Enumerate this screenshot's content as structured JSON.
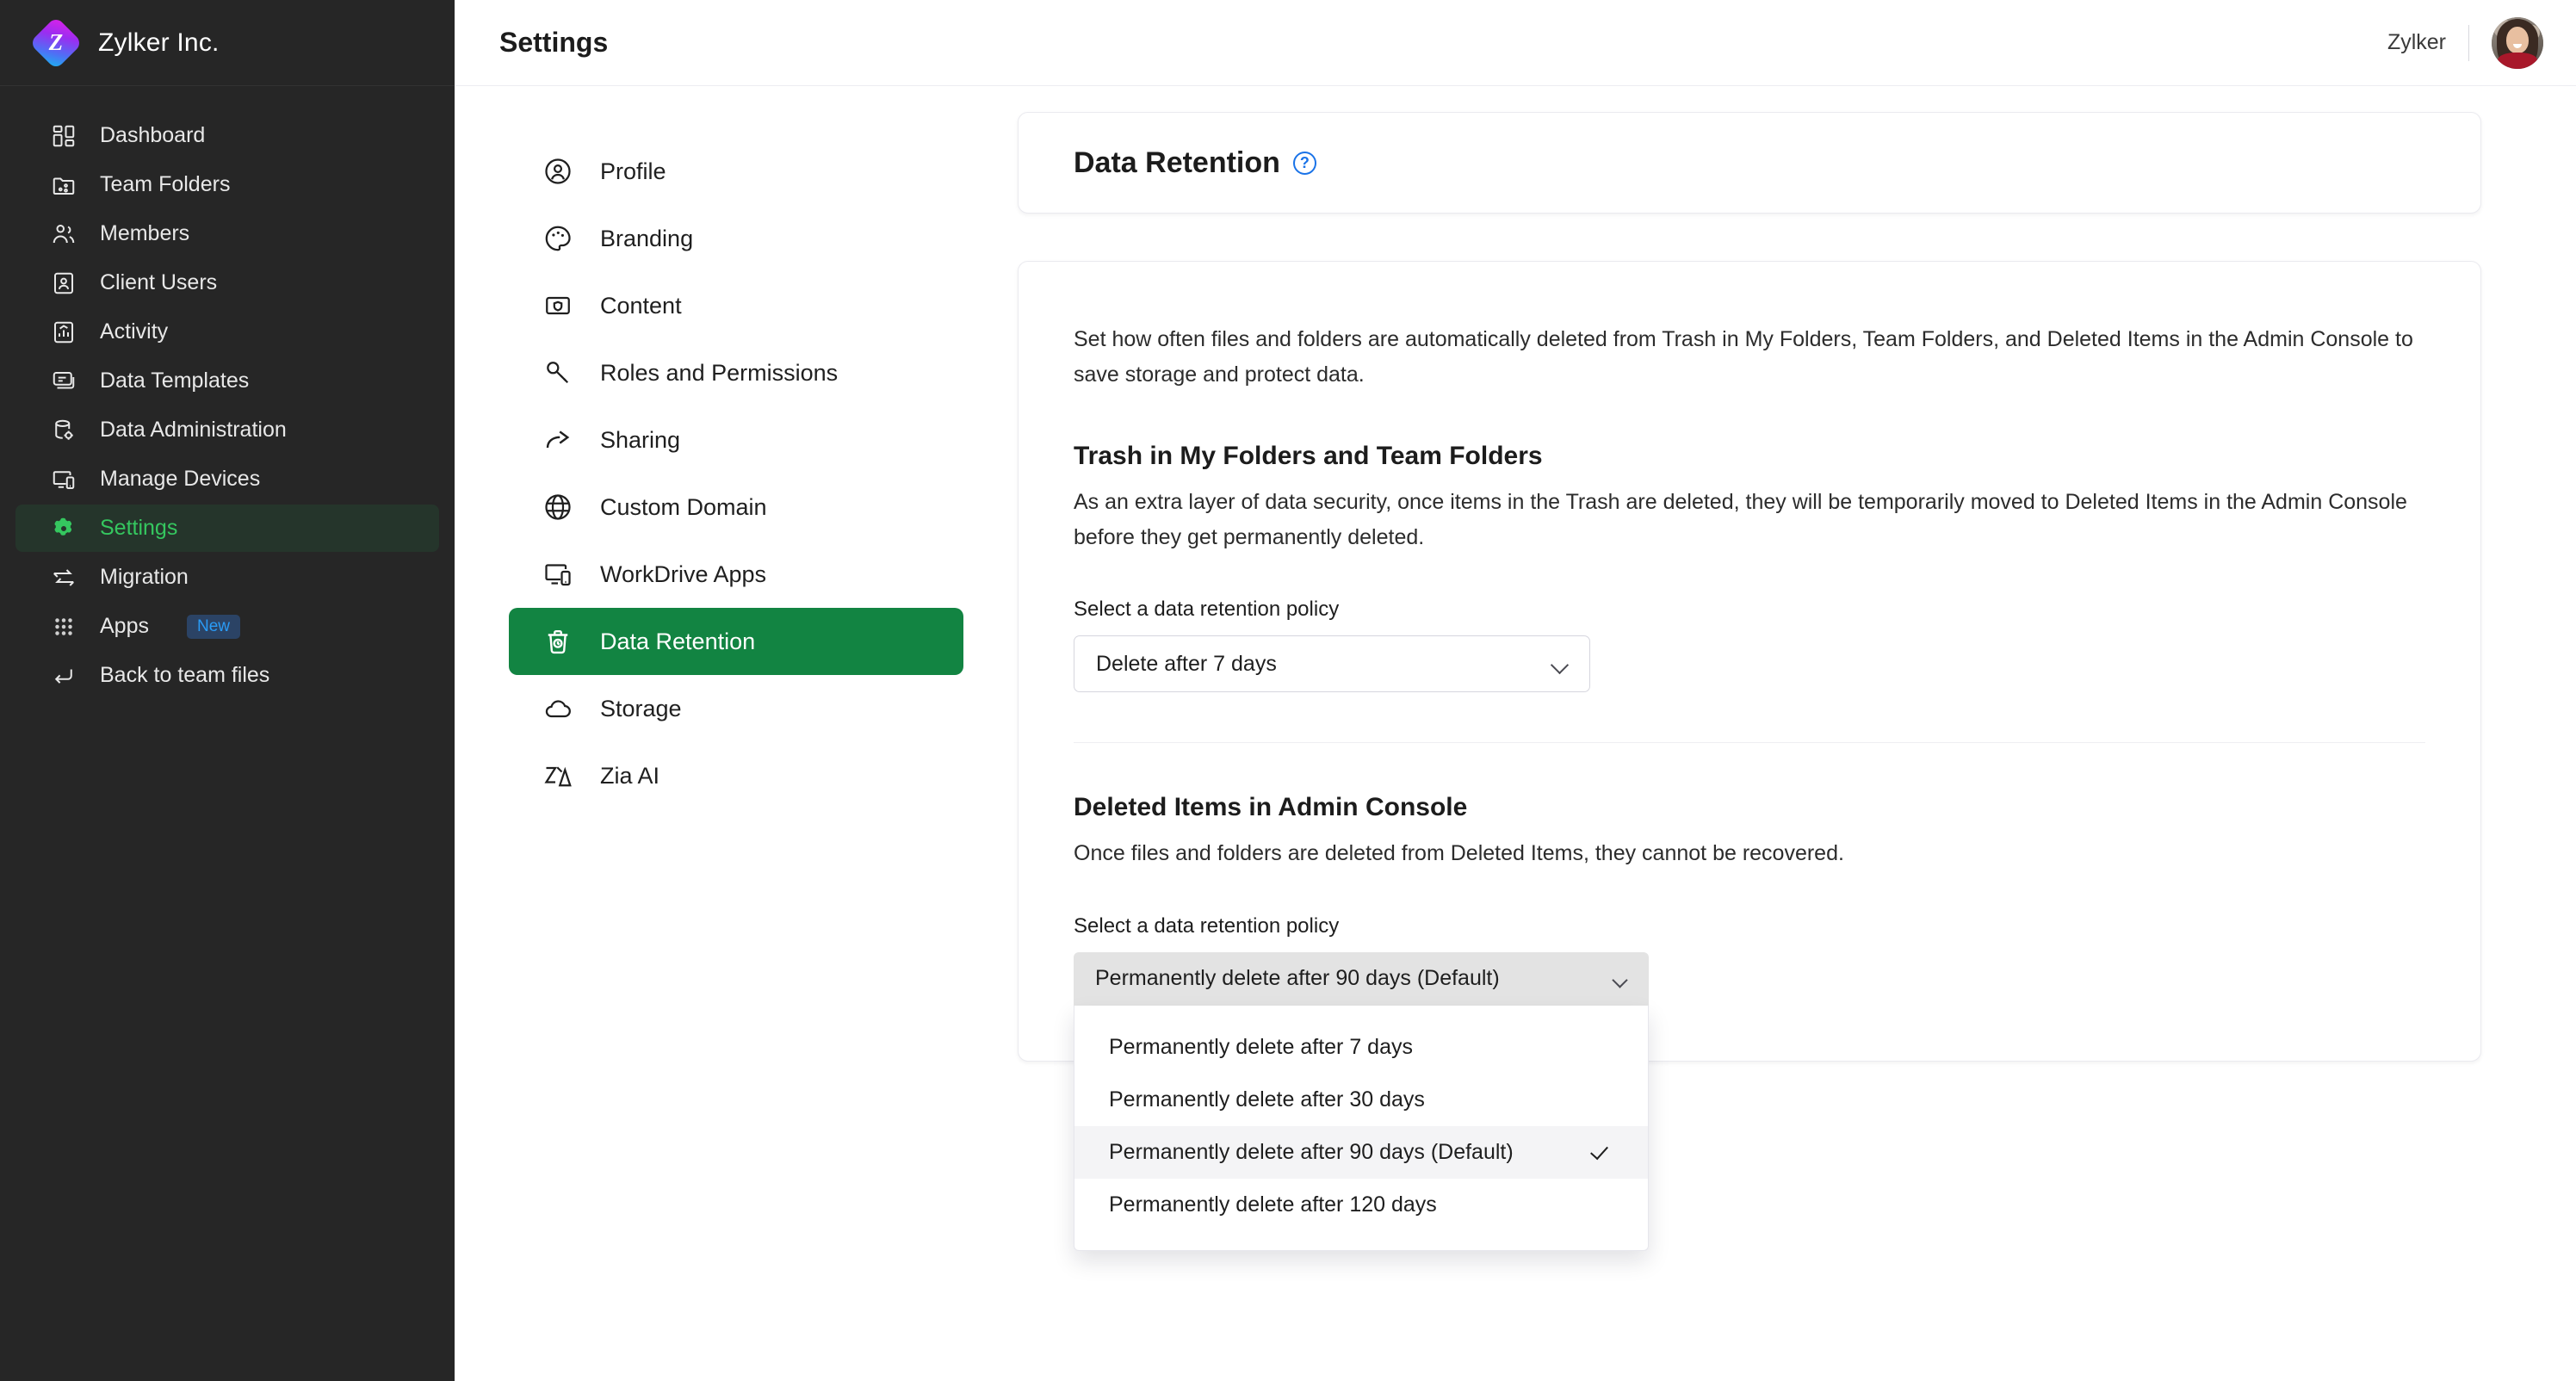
{
  "brand": {
    "name": "Zylker Inc.",
    "logo_glyph": "Z"
  },
  "sidebar": {
    "items": [
      {
        "label": "Dashboard",
        "icon": "grid-icon",
        "active": false
      },
      {
        "label": "Team Folders",
        "icon": "folder-share-icon",
        "active": false
      },
      {
        "label": "Members",
        "icon": "people-icon",
        "active": false
      },
      {
        "label": "Client Users",
        "icon": "id-card-icon",
        "active": false
      },
      {
        "label": "Activity",
        "icon": "activity-report-icon",
        "active": false
      },
      {
        "label": "Data Templates",
        "icon": "template-icon",
        "active": false
      },
      {
        "label": "Data Administration",
        "icon": "database-gear-icon",
        "active": false
      },
      {
        "label": "Manage Devices",
        "icon": "devices-icon",
        "active": false
      },
      {
        "label": "Settings",
        "icon": "gear-icon",
        "active": true
      },
      {
        "label": "Migration",
        "icon": "transfer-arrows-icon",
        "active": false
      },
      {
        "label": "Apps",
        "icon": "apps-grid-icon",
        "active": false,
        "badge": "New"
      },
      {
        "label": "Back to team files",
        "icon": "return-arrow-icon",
        "active": false
      }
    ]
  },
  "topbar": {
    "title": "Settings",
    "org_name": "Zylker",
    "avatar_name": "user-avatar"
  },
  "settings_nav": {
    "items": [
      {
        "label": "Profile",
        "icon": "user-circle-icon",
        "active": false
      },
      {
        "label": "Branding",
        "icon": "palette-icon",
        "active": false
      },
      {
        "label": "Content",
        "icon": "content-shield-icon",
        "active": false
      },
      {
        "label": "Roles and Permissions",
        "icon": "key-icon",
        "active": false
      },
      {
        "label": "Sharing",
        "icon": "share-arrow-icon",
        "active": false
      },
      {
        "label": "Custom Domain",
        "icon": "globe-icon",
        "active": false
      },
      {
        "label": "WorkDrive Apps",
        "icon": "devices-icon",
        "active": false
      },
      {
        "label": "Data Retention",
        "icon": "trash-clock-icon",
        "active": true
      },
      {
        "label": "Storage",
        "icon": "cloud-icon",
        "active": false
      },
      {
        "label": "Zia AI",
        "icon": "zia-icon",
        "active": false
      }
    ]
  },
  "page": {
    "title": "Data Retention",
    "help_glyph": "?",
    "intro": "Set how often files and folders are automatically deleted from Trash in My Folders, Team Folders, and Deleted Items in the Admin Console to save storage and protect data.",
    "section_trash": {
      "title": "Trash in My Folders and Team Folders",
      "description": "As an extra layer of data security, once items in the Trash are deleted, they will be temporarily moved to Deleted Items in the Admin Console before they get permanently deleted.",
      "field_label": "Select a data retention policy",
      "selected_value": "Delete after 7 days"
    },
    "section_deleted_items": {
      "title": "Deleted Items in Admin Console",
      "description": "Once files and folders are deleted from Deleted Items, they cannot be recovered.",
      "field_label": "Select a data retention policy",
      "selected_value": "Permanently delete after 90 days (Default)",
      "dropdown_open": true,
      "options": [
        {
          "label": "Permanently delete after 7 days",
          "selected": false
        },
        {
          "label": "Permanently delete after 30 days",
          "selected": false
        },
        {
          "label": "Permanently delete after 90 days (Default)",
          "selected": true
        },
        {
          "label": "Permanently delete after 120 days",
          "selected": false
        }
      ]
    }
  },
  "colors": {
    "sidebar_bg": "#262626",
    "sidebar_active_bg": "#25352b",
    "sidebar_active_text": "#35c75f",
    "accent_green": "#128442",
    "badge_bg": "#2b4365",
    "badge_text": "#2a9bf5",
    "help_blue": "#1a73e8"
  }
}
